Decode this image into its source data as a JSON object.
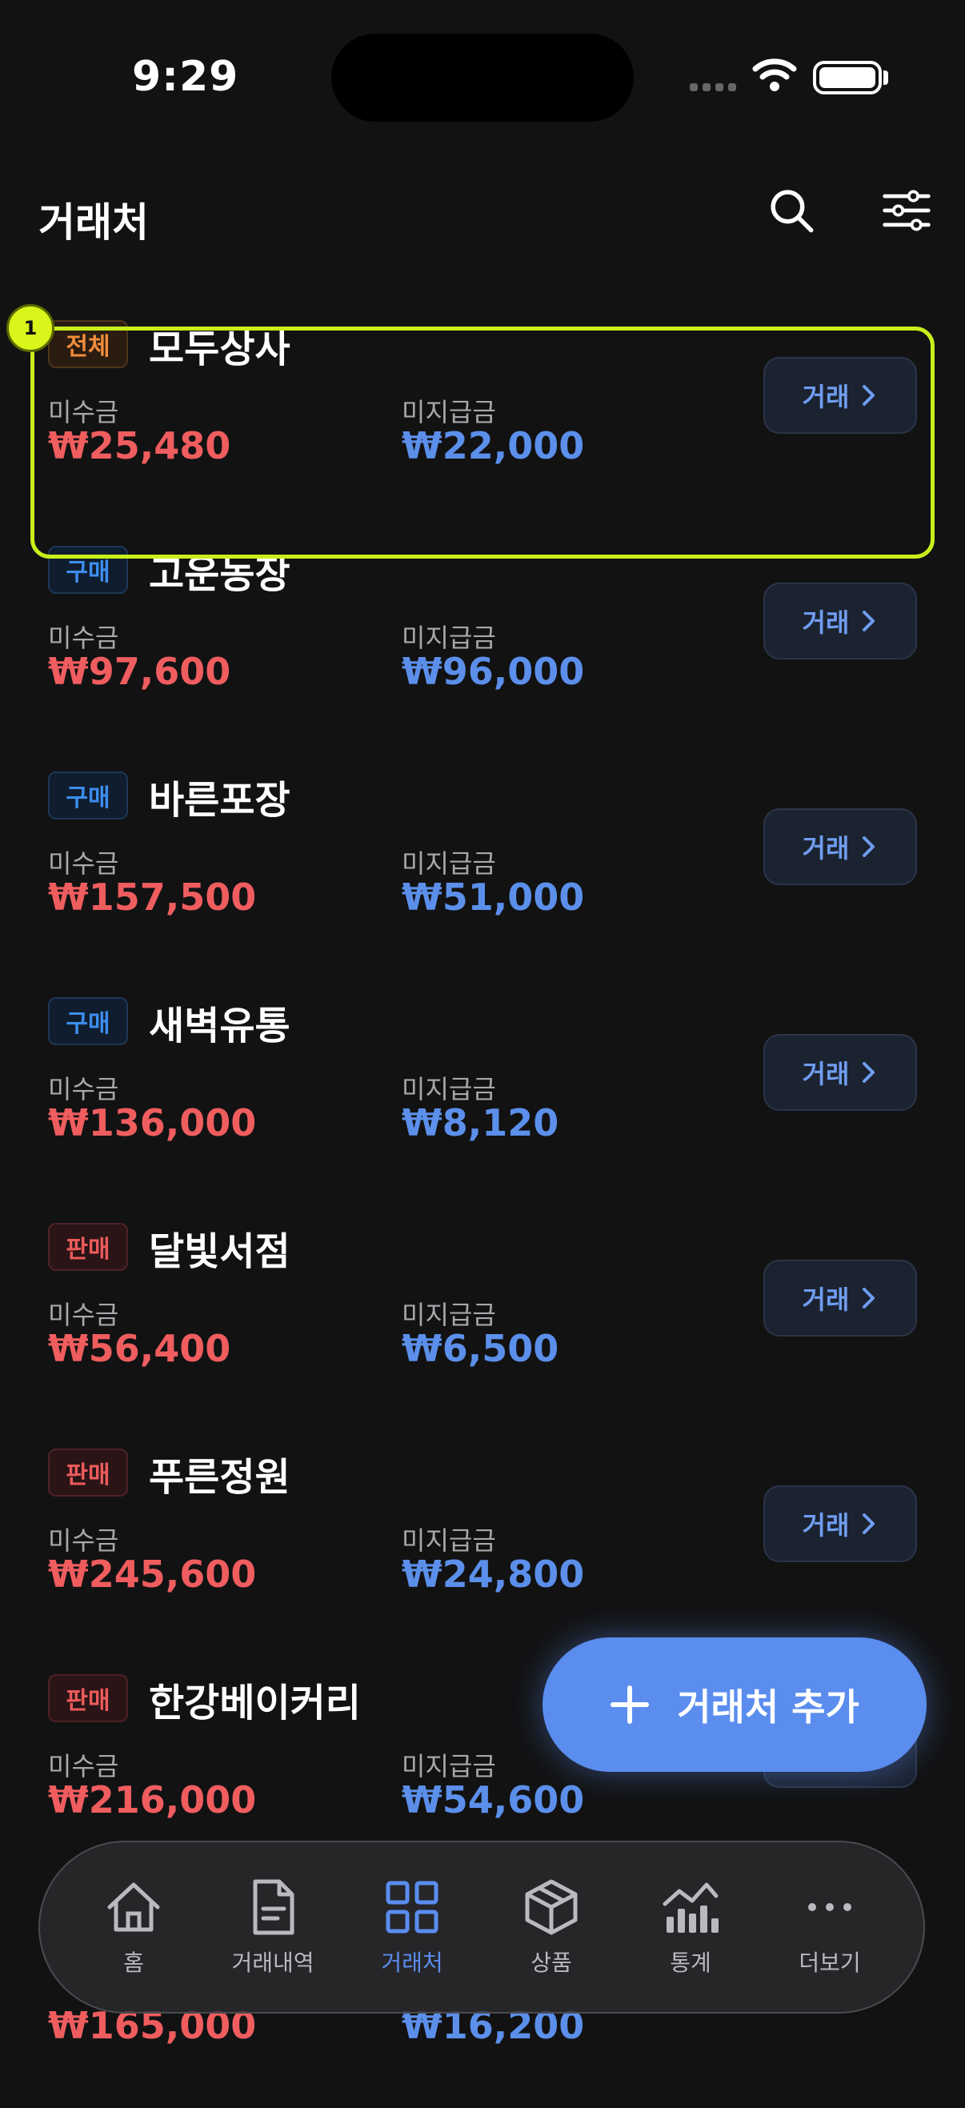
{
  "status": {
    "time": "9:29"
  },
  "header": {
    "title": "거래처"
  },
  "labels": {
    "receivable": "미수금",
    "payable": "미지급금",
    "trade": "거래"
  },
  "partners": [
    {
      "tag": "전체",
      "tag_type": "all",
      "name": "모두상사",
      "receivable": "₩25,480",
      "payable": "₩22,000"
    },
    {
      "tag": "구매",
      "tag_type": "buy",
      "name": "고운농장",
      "receivable": "₩97,600",
      "payable": "₩96,000"
    },
    {
      "tag": "구매",
      "tag_type": "buy",
      "name": "바른포장",
      "receivable": "₩157,500",
      "payable": "₩51,000"
    },
    {
      "tag": "구매",
      "tag_type": "buy",
      "name": "새벽유통",
      "receivable": "₩136,000",
      "payable": "₩8,120"
    },
    {
      "tag": "판매",
      "tag_type": "sell",
      "name": "달빛서점",
      "receivable": "₩56,400",
      "payable": "₩6,500"
    },
    {
      "tag": "판매",
      "tag_type": "sell",
      "name": "푸른정원",
      "receivable": "₩245,600",
      "payable": "₩24,800"
    },
    {
      "tag": "판매",
      "tag_type": "sell",
      "name": "한강베이커리",
      "receivable": "₩216,000",
      "payable": "₩54,600"
    },
    {
      "tag": "",
      "tag_type": "sell",
      "name": "",
      "receivable": "₩165,000",
      "payable": "₩16,200"
    }
  ],
  "highlight": {
    "badge": "1"
  },
  "fab": {
    "label": "거래처 추가"
  },
  "tabs": [
    {
      "label": "홈",
      "icon": "home-icon"
    },
    {
      "label": "거래내역",
      "icon": "document-icon"
    },
    {
      "label": "거래처",
      "icon": "grid-icon"
    },
    {
      "label": "상품",
      "icon": "cube-icon"
    },
    {
      "label": "통계",
      "icon": "chart-icon"
    },
    {
      "label": "더보기",
      "icon": "more-icon"
    }
  ],
  "colors": {
    "accent": "#5B8DEF",
    "receivable": "#EF5D5F",
    "payable": "#5B8FEA",
    "highlight": "#C8EF1B"
  }
}
